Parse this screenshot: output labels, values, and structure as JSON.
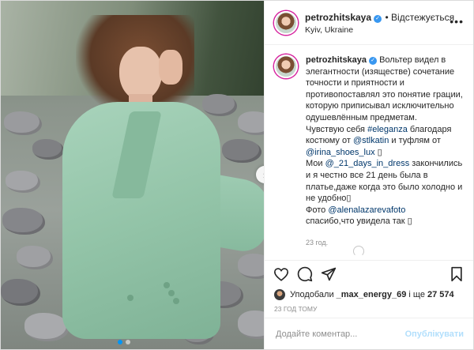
{
  "header": {
    "username": "petrozhitskaya",
    "follow_state": "Відстежується",
    "location": "Kyiv, Ukraine",
    "more_icon": "ellipsis-icon"
  },
  "caption": {
    "username": "petrozhitskaya",
    "text1": "Вольтер видел в элегантности (изяществе) сочетание точности и приятности и противопоставлял это понятие грации, которую приписывал исключительно одушевлённым предметам.",
    "line_prefix": "Чувствую себя",
    "hashtag": "#eleganza",
    "line_mid1": "благодаря костюму от",
    "mention1": "@stlkatin",
    "line_mid2": "и туфлям от",
    "mention2": "@irina_shoes_lux",
    "emoji_box": "▯",
    "moi": "Мои",
    "mention3": "@_21_days_in_dress",
    "text2": "закончились и я честно все 21 день была в платье,даже когда это было холодно и не удобно▯",
    "photo_prefix": "Фото",
    "mention4": "@alenalazarevafoto",
    "text3": "спасибо,что увидела так ▯",
    "time_ago": "23 год."
  },
  "likes": {
    "prefix": "Уподобали",
    "user": "_max_energy_69",
    "mid": "і ще",
    "count": "27 574"
  },
  "posted_ago": "23 ГОД ТОМУ",
  "comment_box": {
    "placeholder": "Додайте коментар...",
    "publish_label": "Опублікувати"
  },
  "colors": {
    "link": "#00376b",
    "publish_disabled": "#b2dffc",
    "verified": "#3897f0",
    "muted": "#8e8e8e"
  }
}
